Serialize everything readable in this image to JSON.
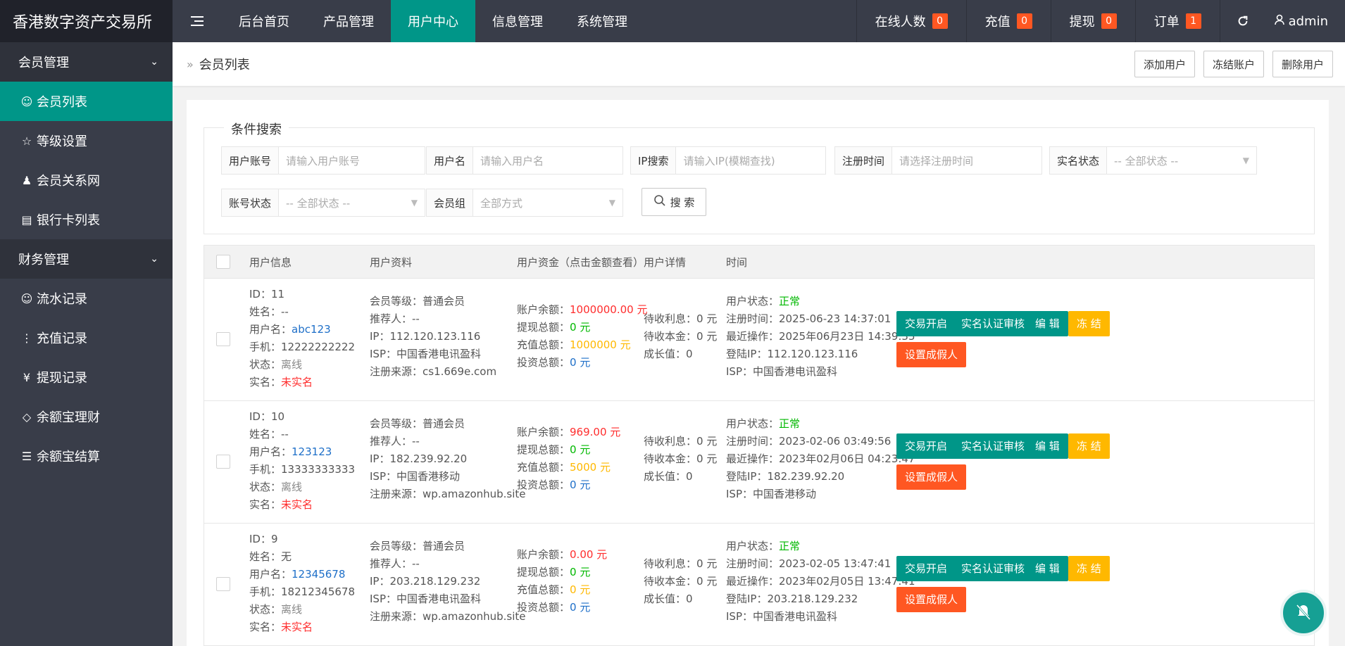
{
  "app_title": "香港数字资产交易所",
  "nav": {
    "toggle_icon": "menu-icon",
    "items": [
      "后台首页",
      "产品管理",
      "用户中心",
      "信息管理",
      "系统管理"
    ],
    "active": "用户中心"
  },
  "top_stats": [
    {
      "label": "在线人数",
      "count": "0"
    },
    {
      "label": "充值",
      "count": "0"
    },
    {
      "label": "提现",
      "count": "0"
    },
    {
      "label": "订单",
      "count": "1"
    }
  ],
  "admin_label": "admin",
  "sidebar": {
    "group1": "会员管理",
    "group1_items": [
      {
        "label": "会员列表",
        "icon": "user-icon"
      },
      {
        "label": "等级设置",
        "icon": "star-icon"
      },
      {
        "label": "会员关系网",
        "icon": "users-icon"
      },
      {
        "label": "银行卡列表",
        "icon": "card-icon"
      }
    ],
    "group2": "财务管理",
    "group2_items": [
      {
        "label": "流水记录",
        "icon": "user-icon"
      },
      {
        "label": "充值记录",
        "icon": "more-vertical-icon"
      },
      {
        "label": "提现记录",
        "icon": "yen-icon"
      },
      {
        "label": "余额宝理财",
        "icon": "diamond-icon"
      },
      {
        "label": "余额宝结算",
        "icon": "list-icon"
      }
    ]
  },
  "breadcrumb": "会员列表",
  "actions": {
    "add": "添加用户",
    "freeze": "冻结账户",
    "delete": "删除用户"
  },
  "search": {
    "legend": "条件搜索",
    "account_label": "用户账号",
    "account_placeholder": "请输入用户账号",
    "name_label": "用户名",
    "name_placeholder": "请输入用户名",
    "ip_label": "IP搜索",
    "ip_placeholder": "请输入IP(模糊查找)",
    "regtime_label": "注册时间",
    "regtime_placeholder": "请选择注册时间",
    "realname_label": "实名状态",
    "realname_value": "-- 全部状态 --",
    "status_label": "账号状态",
    "status_value": "-- 全部状态 --",
    "group_label": "会员组",
    "group_value": "全部方式",
    "button": "搜 索"
  },
  "table": {
    "headers": [
      "用户信息",
      "用户资料",
      "用户资金（点击金额查看）",
      "用户详情",
      "时间"
    ],
    "labels": {
      "id": "ID：",
      "name": "姓名：",
      "username": "用户名：",
      "phone": "手机：",
      "state": "状态：",
      "realname": "实名：",
      "level": "会员等级：",
      "referrer": "推荐人：",
      "ip": "IP：",
      "isp": "ISP：",
      "source": "注册来源：",
      "balance": "账户余额：",
      "withdraw": "提现总额：",
      "recharge": "充值总额：",
      "invest": "投资总额：",
      "interest": "待收利息：",
      "principal": "待收本金：",
      "growth": "成长值：",
      "user_status": "用户状态：",
      "reg_time": "注册时间：",
      "last_op": "最近操作：",
      "login_ip": "登陆IP：",
      "isp2": "ISP："
    },
    "buttons": {
      "trade": "交易开启",
      "verify": "实名认证审核",
      "edit": "编 辑",
      "freeze": "冻 结",
      "fake": "设置成假人"
    },
    "rows": [
      {
        "id": "11",
        "name": "--",
        "username": "abc123",
        "phone": "12222222222",
        "state": "离线",
        "realname": "未实名",
        "level": "普通会员",
        "referrer": "--",
        "ip": "112.120.123.116",
        "isp": "中国香港电讯盈科",
        "source": "cs1.669e.com",
        "balance": "1000000.00 元",
        "withdraw": "0 元",
        "recharge": "1000000 元",
        "invest": "0 元",
        "interest": "0 元",
        "principal": "0 元",
        "growth": "0",
        "user_status": "正常",
        "reg_time": "2025-06-23 14:37:01",
        "last_op": "2025年06月23日 14:39:35",
        "login_ip": "112.120.123.116",
        "isp2": "中国香港电讯盈科"
      },
      {
        "id": "10",
        "name": "--",
        "username": "123123",
        "phone": "13333333333",
        "state": "离线",
        "realname": "未实名",
        "level": "普通会员",
        "referrer": "--",
        "ip": "182.239.92.20",
        "isp": "中国香港移动",
        "source": "wp.amazonhub.site",
        "balance": "969.00 元",
        "withdraw": "0 元",
        "recharge": "5000 元",
        "invest": "0 元",
        "interest": "0 元",
        "principal": "0 元",
        "growth": "0",
        "user_status": "正常",
        "reg_time": "2023-02-06 03:49:56",
        "last_op": "2023年02月06日 04:23:47",
        "login_ip": "182.239.92.20",
        "isp2": "中国香港移动"
      },
      {
        "id": "9",
        "name": "无",
        "username": "12345678",
        "phone": "18212345678",
        "state": "离线",
        "realname": "未实名",
        "level": "普通会员",
        "referrer": "--",
        "ip": "203.218.129.232",
        "isp": "中国香港电讯盈科",
        "source": "wp.amazonhub.site",
        "balance": "0.00 元",
        "withdraw": "0 元",
        "recharge": "0 元",
        "invest": "0 元",
        "interest": "0 元",
        "principal": "0 元",
        "growth": "0",
        "user_status": "正常",
        "reg_time": "2023-02-05 13:47:41",
        "last_op": "2023年02月05日 13:47:41",
        "login_ip": "203.218.129.232",
        "isp2": "中国香港电讯盈科"
      }
    ]
  },
  "colors": {
    "teal": "#009688",
    "dark": "#393d49",
    "darker": "#20222a",
    "badge": "#ff5722",
    "yellow": "#ffb800"
  }
}
